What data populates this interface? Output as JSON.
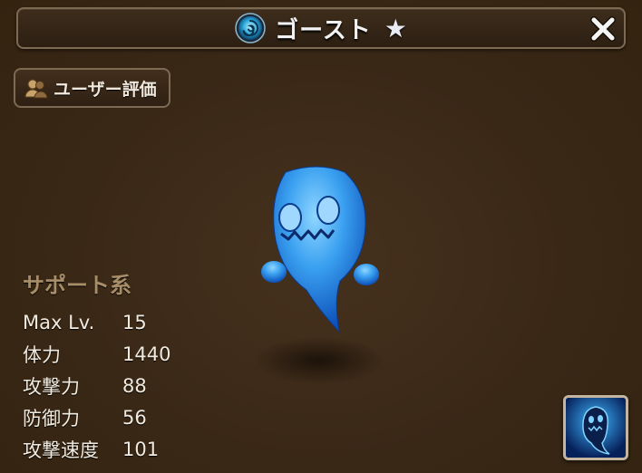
{
  "header": {
    "title": "ゴースト",
    "element_icon": "wind-element-icon",
    "rarity_icon": "star-icon",
    "rarity_stars": 1,
    "close_icon": "close-icon"
  },
  "review_button": {
    "label": "ユーザー評価",
    "icon": "users-icon"
  },
  "monster": {
    "category": "サポート系",
    "stats": [
      {
        "label": "Max Lv.",
        "value": "15"
      },
      {
        "label": "体力",
        "value": "1440"
      },
      {
        "label": "攻撃力",
        "value": "88"
      },
      {
        "label": "防御力",
        "value": "56"
      },
      {
        "label": "攻撃速度",
        "value": "101"
      }
    ]
  },
  "skill": {
    "icon": "ghost-skill-icon"
  },
  "colors": {
    "background": "#3b2918",
    "frame": "#7d6a52",
    "category_text": "#a78d68",
    "stat_text": "#f1ebdf",
    "monster_blue": "#3aa0f0"
  }
}
